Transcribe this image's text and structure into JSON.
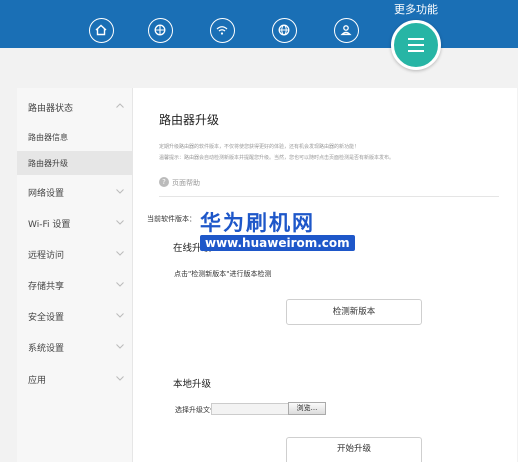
{
  "topbar": {
    "more_label": "更多功能",
    "nav_icons": [
      "home-icon",
      "globe-icon",
      "wifi-icon",
      "network-icon",
      "user-icon"
    ],
    "more_icon": "menu-icon",
    "colors": {
      "bar": "#1a6fb5",
      "more": "#27b5a5"
    }
  },
  "sidebar": {
    "status": "路由器状态",
    "router_info": "路由器信息",
    "router_upgrade": "路由器升级",
    "network": "网络设置",
    "wifi": "Wi-Fi 设置",
    "remote": "远程访问",
    "storage": "存储共享",
    "security": "安全设置",
    "system": "系统设置",
    "apps": "应用"
  },
  "main": {
    "title": "路由器升级",
    "desc1": "定期升级路由器的软件版本，不仅将使您获得更好的体验，还有机会发现路由器的新功能！",
    "desc2": "温馨提示：路由器会自动检测新版本并提醒您升级。当然，您也可以随时点击页面检测是否有新版本发布。",
    "help_icon": "?",
    "help": "页面帮助",
    "current_version": "当前软件版本：",
    "online_title": "在线升级",
    "online_hint": "点击\"检测新版本\"进行版本检测",
    "check_button": "检测新版本",
    "local_title": "本地升级",
    "file_label": "选择升级文件：",
    "browse_button": "浏览...",
    "start_button": "开始升级"
  },
  "watermark": {
    "cn": "华为刷机网",
    "url": "www.huaweirom.com"
  }
}
